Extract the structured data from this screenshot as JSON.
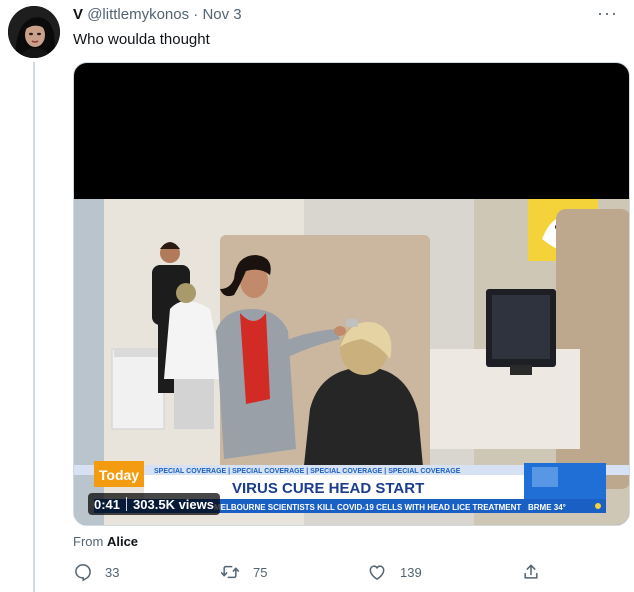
{
  "tweet": {
    "author_name": "V",
    "handle": "@littlemykonos",
    "separator": "·",
    "date": "Nov 3",
    "text": "Who woulda thought",
    "more": "···"
  },
  "media": {
    "tv_logo": "Today",
    "headline": "VIRUS CURE HEAD START",
    "banner_strip": "SPECIAL COVERAGE | SPECIAL COVERAGE | SPECIAL COVERAGE | SPECIAL COVERAGE",
    "ticker": "MELBOURNE SCIENTISTS KILL COVID-19 CELLS WITH HEAD LICE TREATMENT",
    "weather": "BRME 34°",
    "duration": "0:41",
    "views": "303.5K views"
  },
  "source": {
    "prefix": "From",
    "name": "Alice"
  },
  "actions": {
    "reply_count": "33",
    "retweet_count": "75",
    "like_count": "139"
  },
  "colors": {
    "text": "#0f1419",
    "secondary": "#536471",
    "banner_blue": "#1a5fc4",
    "logo_orange": "#f39c12"
  }
}
